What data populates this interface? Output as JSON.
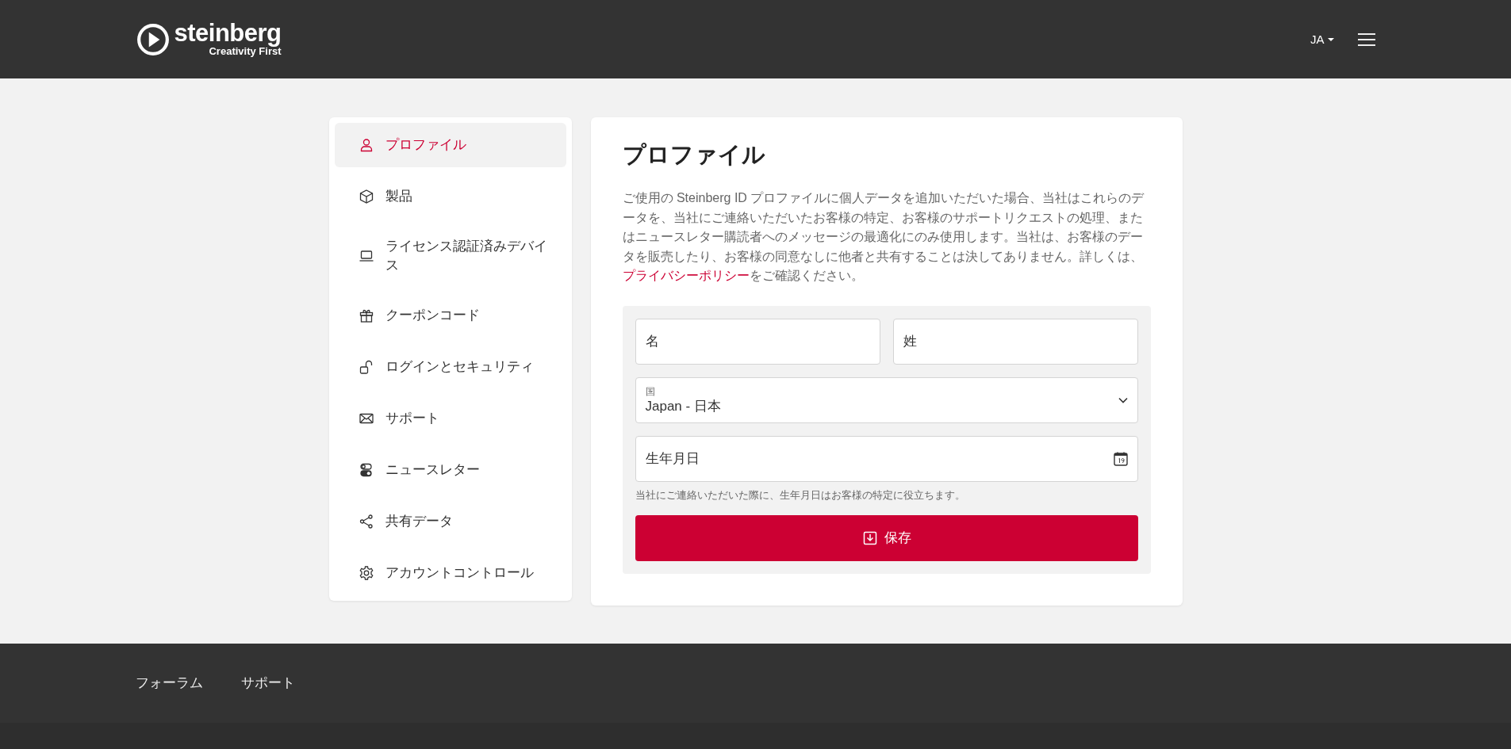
{
  "header": {
    "logo": {
      "name": "steinberg",
      "tagline": "Creativity First"
    },
    "language": "JA"
  },
  "sidebar": {
    "items": [
      {
        "label": "プロファイル",
        "selected": true
      },
      {
        "label": "製品",
        "selected": false
      },
      {
        "label": "ライセンス認証済みデバイス",
        "selected": false
      },
      {
        "label": "クーポンコード",
        "selected": false
      },
      {
        "label": "ログインとセキュリティ",
        "selected": false
      },
      {
        "label": "サポート",
        "selected": false
      },
      {
        "label": "ニュースレター",
        "selected": false
      },
      {
        "label": "共有データ",
        "selected": false
      },
      {
        "label": "アカウントコントロール",
        "selected": false
      }
    ]
  },
  "profile": {
    "title": "プロファイル",
    "intro": {
      "before": "ご使用の Steinberg ID プロファイルに個人データを追加いただいた場合、当社はこれらのデータを、当社にご連絡いただいたお客様の特定、お客様のサポートリクエストの処理、またはニュースレター購読者へのメッセージの最適化にのみ使用します。当社は、お客様のデータを販売したり、お客様の同意なしに他者と共有することは決してありません。詳しくは、",
      "link": "プライバシーポリシー",
      "after": "をご確認ください。"
    },
    "form": {
      "first_name": {
        "placeholder": "名"
      },
      "last_name": {
        "placeholder": "姓"
      },
      "country": {
        "label": "国",
        "value": "Japan - 日本"
      },
      "birthday": {
        "placeholder": "生年月日",
        "hint": "当社にご連絡いただいた際に、生年月日はお客様の特定に役立ちます。"
      },
      "save_button": "保存"
    }
  },
  "footer": {
    "links": [
      "フォーラム",
      "サポート"
    ]
  }
}
